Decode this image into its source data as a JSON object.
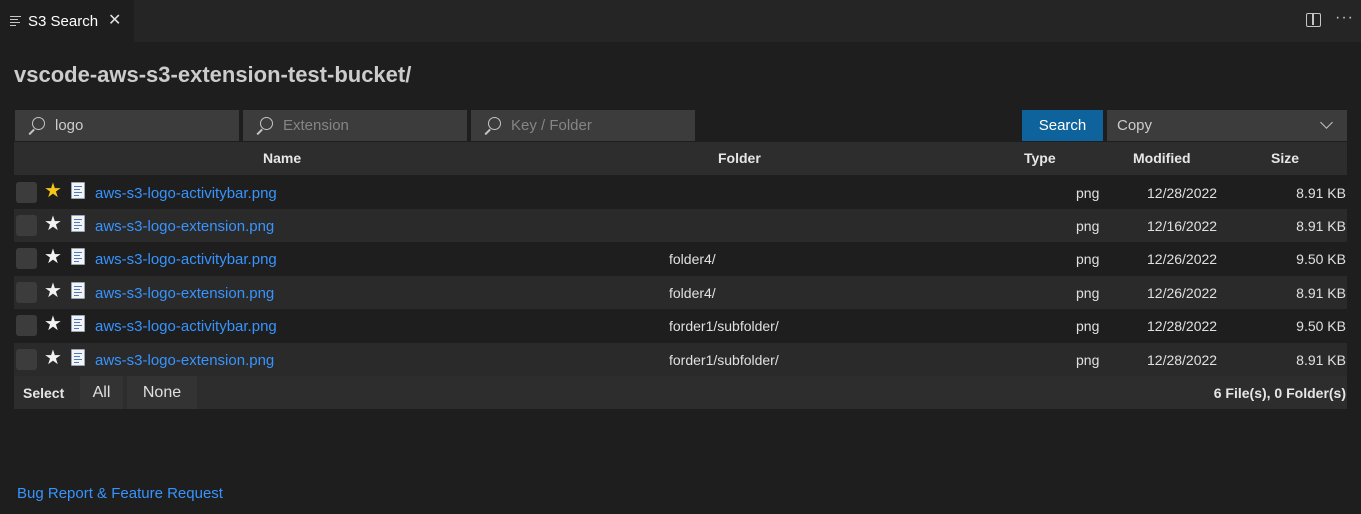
{
  "tab": {
    "title": "S3 Search",
    "close": "✕",
    "more": "···"
  },
  "bucket_title": "vscode-aws-s3-extension-test-bucket/",
  "search": {
    "name_value": "logo",
    "extension_placeholder": "Extension",
    "key_placeholder": "Key / Folder",
    "button_label": "Search",
    "copy_label": "Copy"
  },
  "table": {
    "headers": {
      "name": "Name",
      "folder": "Folder",
      "type": "Type",
      "modified": "Modified",
      "size": "Size"
    },
    "rows": [
      {
        "starred": true,
        "name": "aws-s3-logo-activitybar.png",
        "folder": "",
        "type": "png",
        "modified": "12/28/2022",
        "size": "8.91 KB"
      },
      {
        "starred": false,
        "name": "aws-s3-logo-extension.png",
        "folder": "",
        "type": "png",
        "modified": "12/16/2022",
        "size": "8.91 KB"
      },
      {
        "starred": false,
        "name": "aws-s3-logo-activitybar.png",
        "folder": "folder4/",
        "type": "png",
        "modified": "12/26/2022",
        "size": "9.50 KB"
      },
      {
        "starred": false,
        "name": "aws-s3-logo-extension.png",
        "folder": "folder4/",
        "type": "png",
        "modified": "12/26/2022",
        "size": "8.91 KB"
      },
      {
        "starred": false,
        "name": "aws-s3-logo-activitybar.png",
        "folder": "forder1/subfolder/",
        "type": "png",
        "modified": "12/28/2022",
        "size": "9.50 KB"
      },
      {
        "starred": false,
        "name": "aws-s3-logo-extension.png",
        "folder": "forder1/subfolder/",
        "type": "png",
        "modified": "12/28/2022",
        "size": "8.91 KB"
      }
    ]
  },
  "footer": {
    "select_label": "Select",
    "all_label": "All",
    "none_label": "None",
    "count": "6 File(s), 0 Folder(s)"
  },
  "bug_report_link": "Bug Report & Feature Request",
  "colors": {
    "accent": "#0e639c",
    "link": "#3794ff",
    "star_active": "#f5c518"
  }
}
